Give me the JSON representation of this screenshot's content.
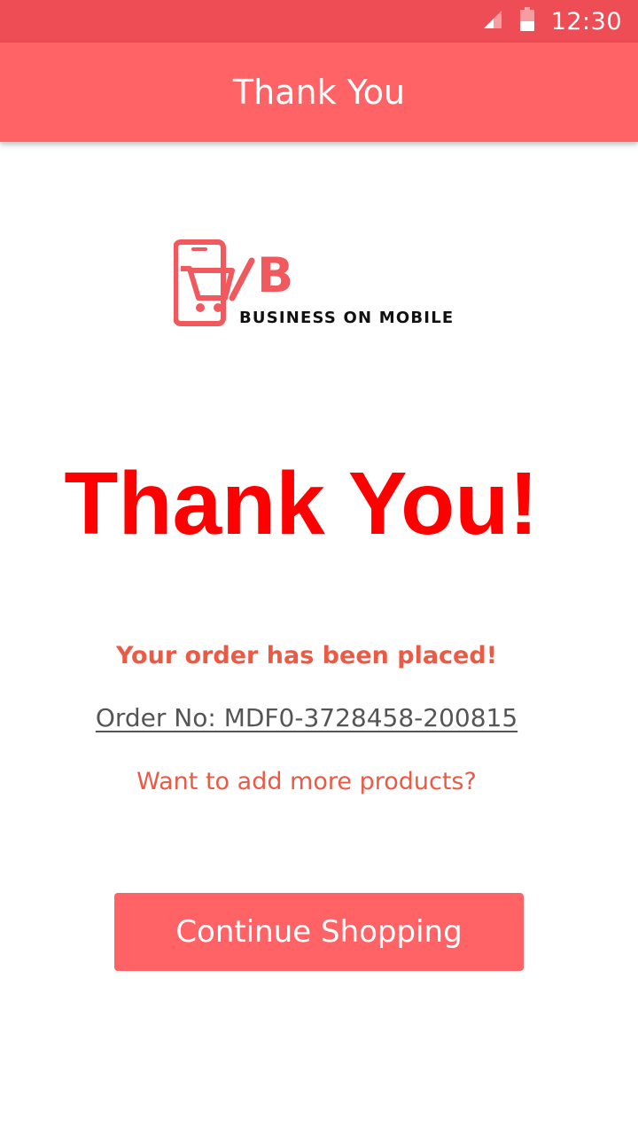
{
  "status_bar": {
    "time": "12:30",
    "icons": [
      "signal-icon",
      "battery-icon"
    ],
    "background": "#ee4d55"
  },
  "app_bar": {
    "title": "Thank You",
    "background": "#ff6366"
  },
  "logo": {
    "text": "BUSINESS ON MOBILE",
    "letter": "B",
    "color": "#f05a5e"
  },
  "main": {
    "heading": "Thank You!",
    "order_placed": "Your order has been placed!",
    "order_number": "Order No: MDF0-3728458-200815",
    "more_products": "Want to add more products?",
    "continue_button": "Continue Shopping"
  },
  "colors": {
    "accent": "#ff6366",
    "heading": "#ff0000",
    "message": "#ea5a45",
    "order_text": "#555555"
  }
}
